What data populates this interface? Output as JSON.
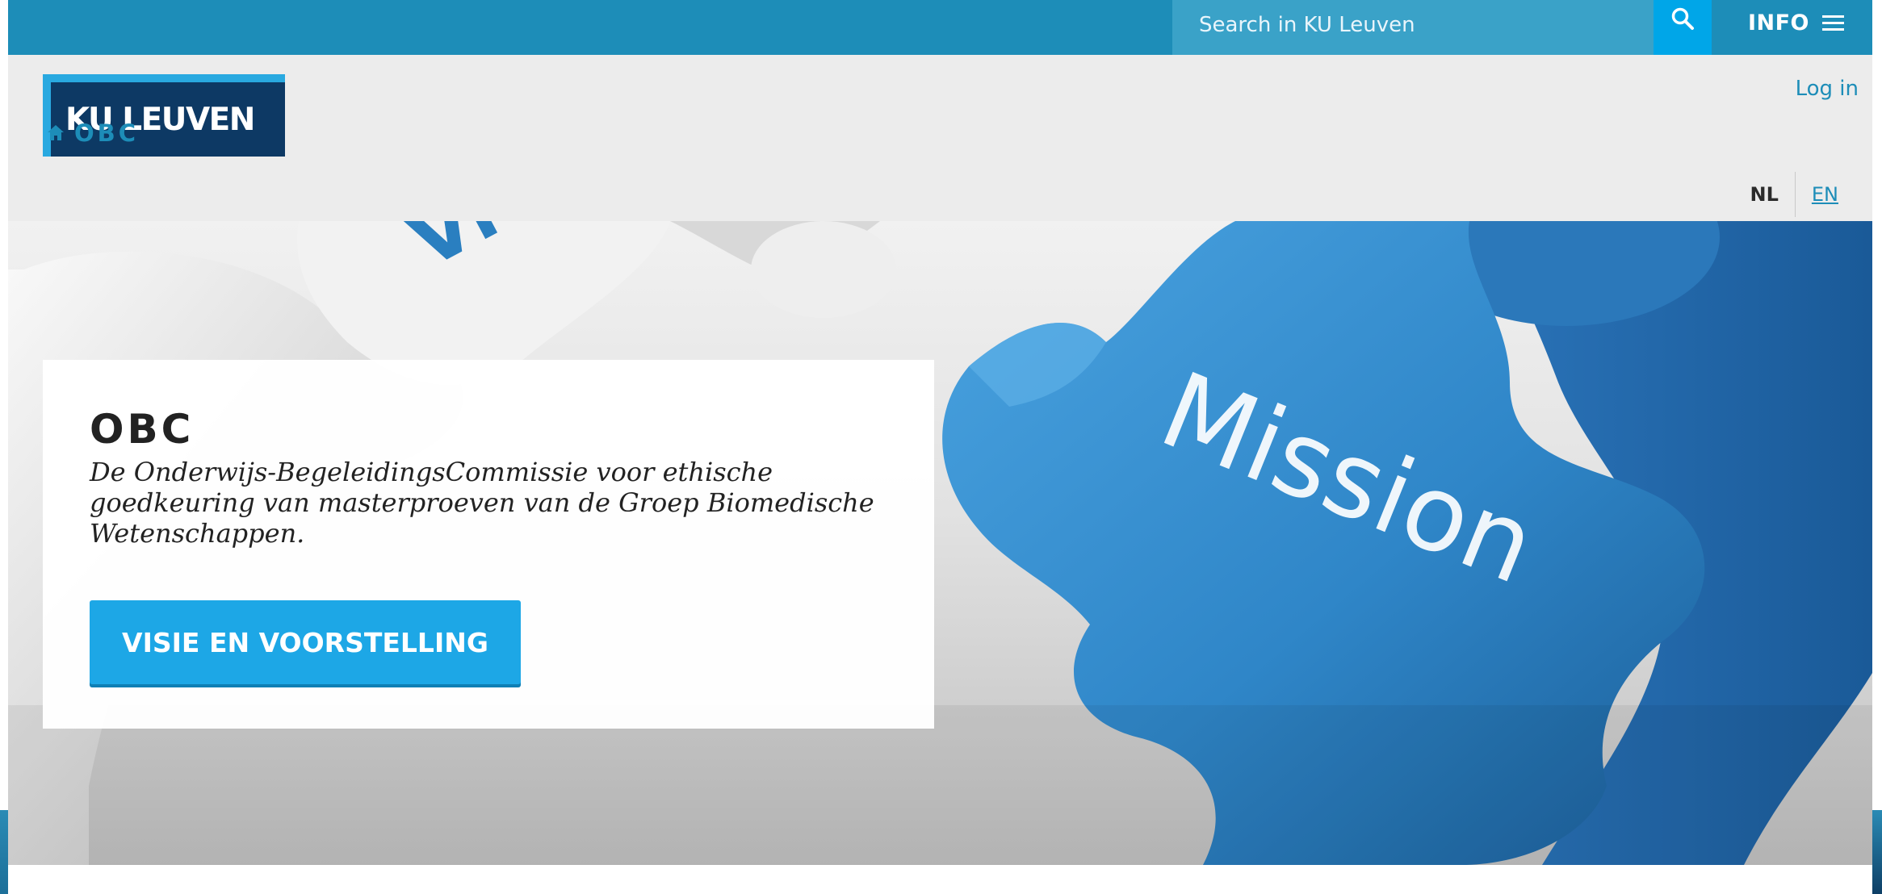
{
  "topbar": {
    "search_placeholder": "Search in KU Leuven",
    "info_label": "INFO",
    "icons": {
      "search": "search-icon",
      "menu": "hamburger-menu-icon"
    }
  },
  "header": {
    "logo_text": "KU LEUVEN",
    "login_label": "Log in",
    "breadcrumb_label": "OBC",
    "breadcrumb_icon": "home-icon",
    "languages": {
      "active": "NL",
      "alternate": "EN"
    }
  },
  "hero": {
    "title": "OBC",
    "description": "De Onderwijs-BegeleidingsCommissie voor ethische goedkeuring van masterproeven van de Groep Biomedische Wetenschappen.",
    "button_label": "VISIE EN VOORSTELLING",
    "image_word": "Mission",
    "image_partial_word": "Vi"
  },
  "colors": {
    "topbar": "#1d8db8",
    "search_field": "#3aa2c8",
    "search_button": "#00a6e8",
    "header_bg": "#ececec",
    "logo_bg": "#0d3964",
    "logo_accent": "#29a9e0",
    "link": "#1d8db8",
    "cta": "#1da7e6",
    "puzzle_blue": "#2f86c8"
  }
}
